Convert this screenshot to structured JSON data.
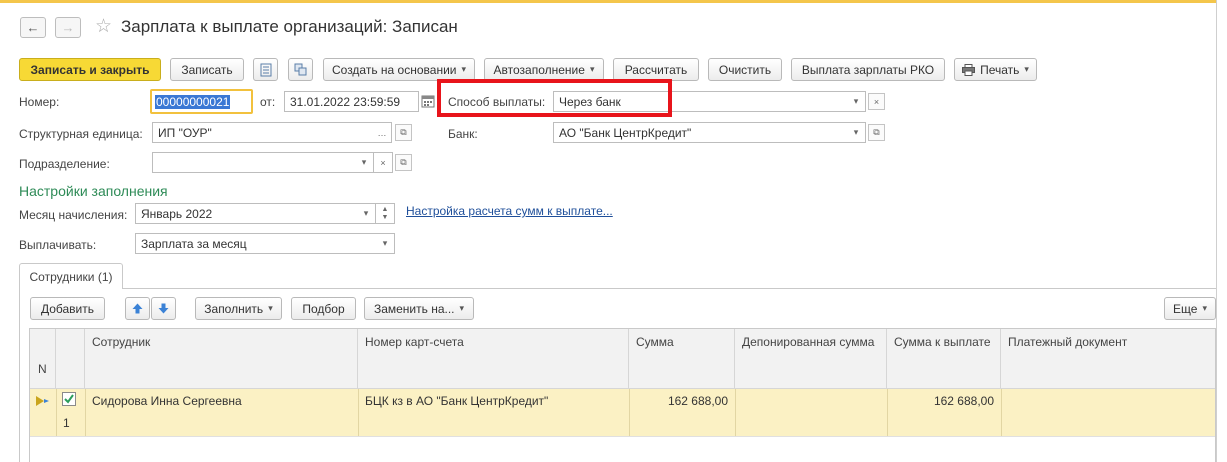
{
  "window": {
    "title": "Зарплата к выплате организаций: Записан",
    "back_icon": "←",
    "forward_icon": "→",
    "star_icon": "☆",
    "close_icon": "×"
  },
  "toolbar": {
    "save_close": "Записать и закрыть",
    "save": "Записать",
    "create_based": "Создать на основании",
    "autofill": "Автозаполнение",
    "calculate": "Рассчитать",
    "clear": "Очистить",
    "rko": "Выплата зарплаты РКО",
    "print": "Печать"
  },
  "form": {
    "number_label": "Номер:",
    "number_value": "00000000021",
    "date_label": "от:",
    "date_value": "31.01.2022 23:59:59",
    "pay_method_label": "Способ выплаты:",
    "pay_method_value": "Через банк",
    "unit_label": "Структурная единица:",
    "unit_value": "ИП \"ОУР\"",
    "bank_label": "Банк:",
    "bank_value": "АО \"Банк ЦентрКредит\"",
    "dept_label": "Подразделение:",
    "dept_value": ""
  },
  "fill_settings": {
    "heading": "Настройки заполнения",
    "month_label": "Месяц начисления:",
    "month_value": "Январь 2022",
    "settings_link": "Настройка расчета сумм к выплате...",
    "pay_label": "Выплачивать:",
    "pay_value": "Зарплата за месяц"
  },
  "tabs": [
    {
      "label": "Сотрудники (1)"
    }
  ],
  "table_toolbar": {
    "add": "Добавить",
    "fill": "Заполнить",
    "pick": "Подбор",
    "replace": "Заменить на...",
    "more": "Еще"
  },
  "table": {
    "n_header": "N",
    "columns": [
      "Сотрудник",
      "Номер карт-счета",
      "Сумма",
      "Депонированная сумма",
      "Сумма к выплате",
      "Платежный документ"
    ],
    "rows": [
      {
        "n": "1",
        "checked": true,
        "employee": "Сидорова Инна Сергеевна",
        "card": "БЦК кз в АО \"Банк ЦентрКредит\"",
        "sum": "162 688,00",
        "deposited": "",
        "to_pay": "162 688,00",
        "payment_doc": ""
      }
    ]
  },
  "colors": {
    "primary_button": "#f7d935",
    "highlight_frame": "#e8141b",
    "section_heading": "#2e8b57",
    "link": "#1f4f9a",
    "selected_row": "#fbf1c4"
  }
}
